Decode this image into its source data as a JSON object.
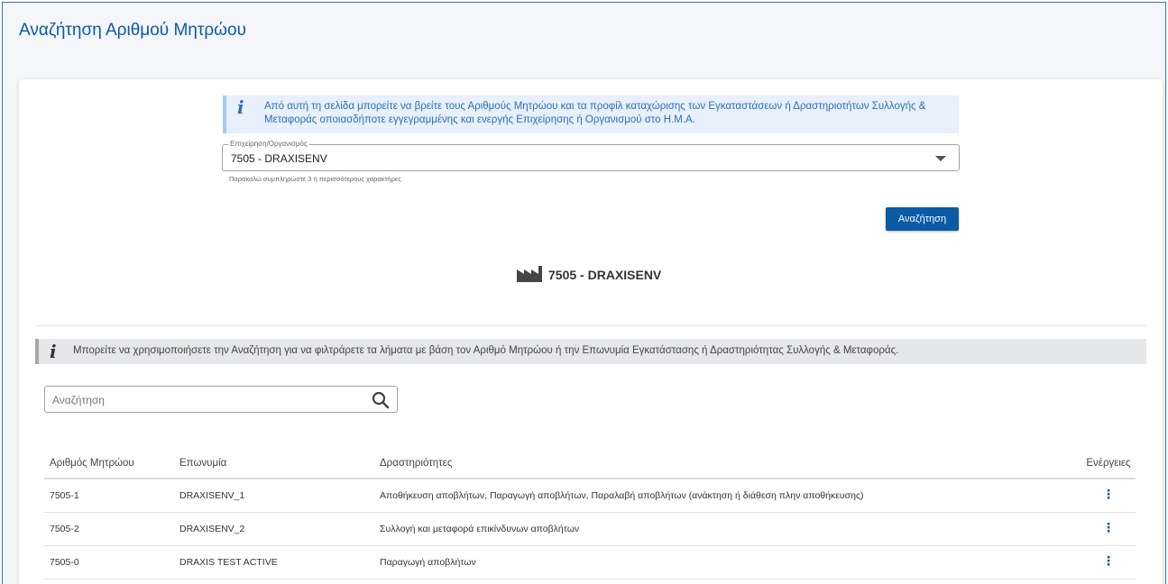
{
  "page": {
    "title": "Αναζήτηση Αριθμού Μητρώου"
  },
  "info": {
    "text": "Από αυτή τη σελίδα μπορείτε να βρείτε τους Αριθμούς Μητρώου και τα προφίλ καταχώρισης των Εγκαταστάσεων ή Δραστηριοτήτων Συλλογής & Μεταφοράς οποιασδήποτε εγγεγραμμένης και ενεργής Επιχείρησης ή Οργανισμού στο Η.Μ.Α.",
    "icon": "info-icon"
  },
  "org_select": {
    "label": "Επιχείρηση/Οργανισμός",
    "value": "7505 - DRAXISENV",
    "hint": "Παρακαλώ συμπληρώστε 3 ή περισσότερους χαρακτήρες"
  },
  "search_button": {
    "label": "Αναζήτηση"
  },
  "org_heading": {
    "text": "7505 - DRAXISENV",
    "icon": "factory-icon"
  },
  "filter_info": {
    "text": "Μπορείτε να χρησιμοποιήσετε την Αναζήτηση για να φιλτράρετε τα λήματα με βάση τον Αριθμό Μητρώου ή την Επωνυμία Εγκατάστασης ή Δραστηριότητας Συλλογής & Μεταφοράς."
  },
  "filter_search": {
    "placeholder": "Αναζήτηση",
    "value": ""
  },
  "table": {
    "headers": {
      "registry": "Αριθμός Μητρώου",
      "name": "Επωνυμία",
      "activities": "Δραστηριότητες",
      "actions": "Ενέργειες"
    },
    "rows": [
      {
        "registry": "7505-1",
        "name": "DRAXISENV_1",
        "activities": "Αποθήκευση αποβλήτων, Παραγωγή αποβλήτων, Παραλαβή αποβλήτων (ανάκτηση ή διάθεση πλην αποθήκευσης)"
      },
      {
        "registry": "7505-2",
        "name": "DRAXISENV_2",
        "activities": "Συλλογή και μεταφορά επικίνδυνων αποβλήτων"
      },
      {
        "registry": "7505-0",
        "name": "DRAXIS TEST ACTIVE",
        "activities": "Παραγωγή αποβλήτων"
      }
    ],
    "action_icon": "more-vertical-icon"
  },
  "colors": {
    "primary": "#0b5aa6",
    "info_bg": "#e7f0fb",
    "border": "#3b73b9"
  }
}
